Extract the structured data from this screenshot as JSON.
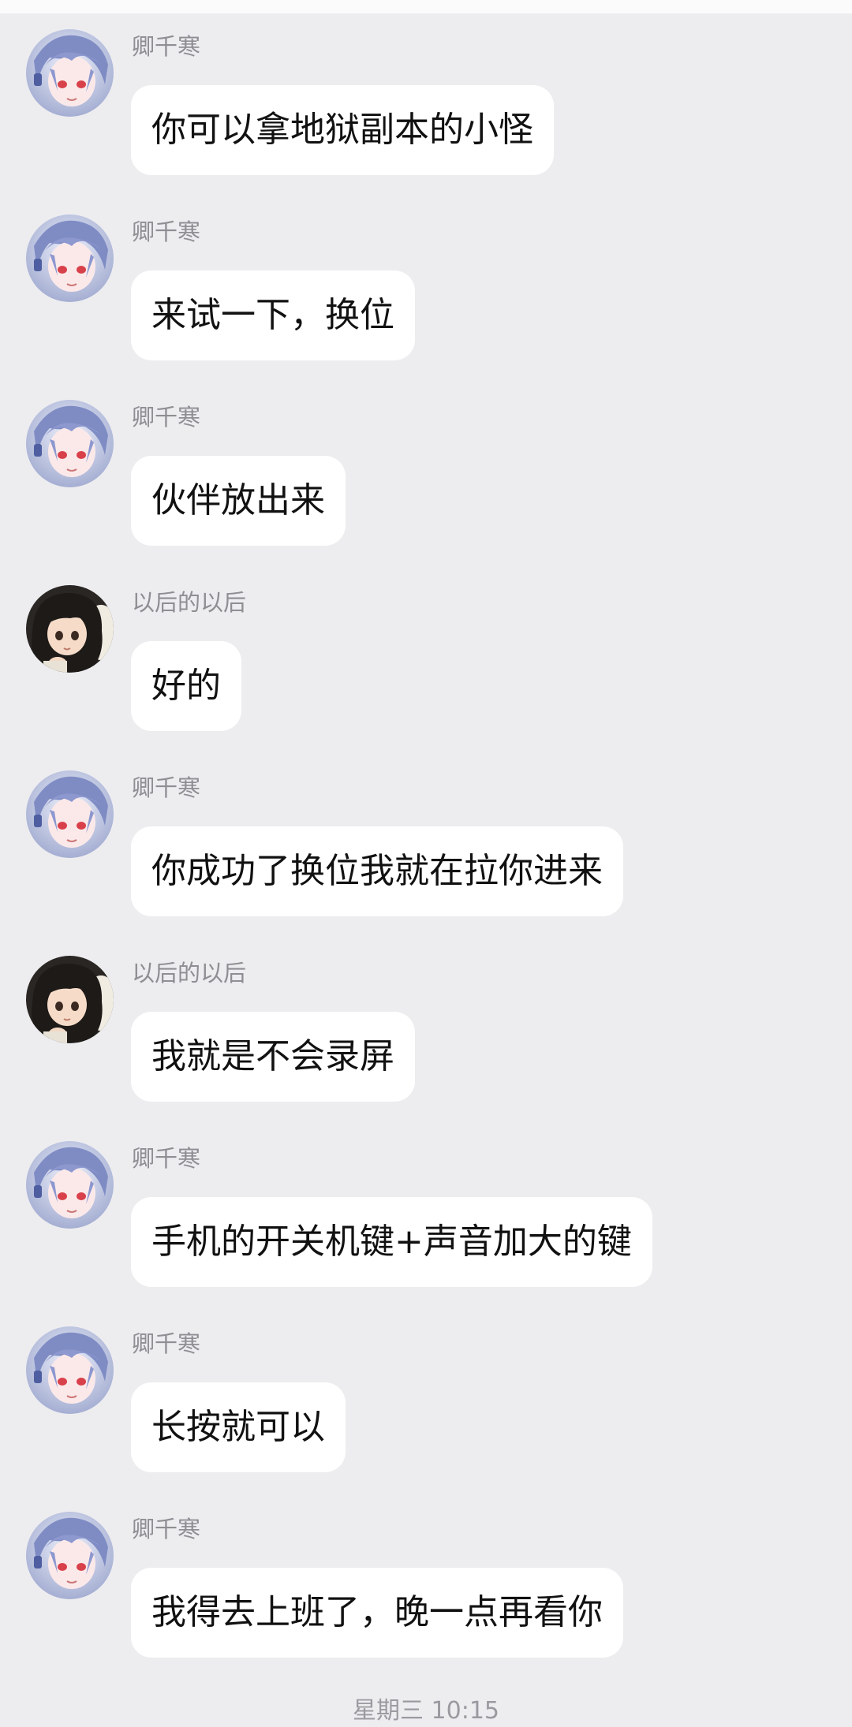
{
  "messages": [
    {
      "sender": "卿千寒",
      "avatar": "anime-silver-hair-avatar",
      "text": "你可以拿地狱副本的小怪"
    },
    {
      "sender": "卿千寒",
      "avatar": "anime-silver-hair-avatar",
      "text": "来试一下，换位"
    },
    {
      "sender": "卿千寒",
      "avatar": "anime-silver-hair-avatar",
      "text": "伙伴放出来"
    },
    {
      "sender": "以后的以后",
      "avatar": "anime-dark-hair-avatar",
      "text": "好的"
    },
    {
      "sender": "卿千寒",
      "avatar": "anime-silver-hair-avatar",
      "text": "你成功了换位我就在拉你进来"
    },
    {
      "sender": "以后的以后",
      "avatar": "anime-dark-hair-avatar",
      "text": "我就是不会录屏"
    },
    {
      "sender": "卿千寒",
      "avatar": "anime-silver-hair-avatar",
      "text": "手机的开关机键+声音加大的键"
    },
    {
      "sender": "卿千寒",
      "avatar": "anime-silver-hair-avatar",
      "text": "长按就可以"
    },
    {
      "sender": "卿千寒",
      "avatar": "anime-silver-hair-avatar",
      "text": "我得去上班了，晚一点再看你"
    }
  ],
  "time_separator": "星期三 10:15",
  "colors": {
    "background": "#ededf0",
    "bubble": "#ffffff",
    "sender_name": "#8e8e93",
    "message_text": "#111111"
  }
}
